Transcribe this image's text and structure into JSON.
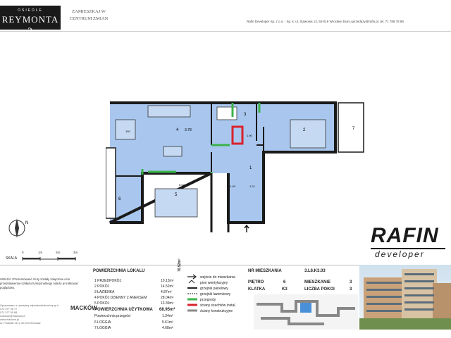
{
  "header": {
    "logo_top": "OSIEDLE",
    "logo_main": "REYMONTA 3",
    "slogan": "ZAMIESZKAJ W CENTRUM ZMIAN",
    "company": "Rafin Developer Sp. z o.o. - Sp. k. ul. Stawowa 13, 50-018 Wrocław, biuro.sprzedazy@rafin.pl, tel. 71 788 78 88"
  },
  "plan": {
    "rooms": [
      {
        "num": "4",
        "dim": "3.78"
      },
      {
        "num": "3"
      },
      {
        "num": "2"
      },
      {
        "num": "1"
      },
      {
        "num": "5"
      },
      {
        "num": "6"
      },
      {
        "num": "7"
      }
    ],
    "dims": [
      "150",
      "3.78",
      "6.52",
      "1.45",
      "1.21",
      "1.90"
    ]
  },
  "scale": {
    "label": "SKALA",
    "ticks": [
      "0",
      "1m",
      "2m",
      "3m"
    ],
    "compass": "N"
  },
  "brand": {
    "name": "RAFIN",
    "sub": "developer"
  },
  "disclaimer": "UWAGA ! Prezentowane rzuty zostały załączone celu przedstawienia rozkładu funkcjonalnego należy je traktować poglądowo.",
  "architect": {
    "lines": [
      "Opracowano z uprzejmą odpowiedzialnością sp.k.",
      "071 377 05 77",
      "071 377 05 88",
      "mackow@mackow.pl",
      "www.mackow.pl",
      "ul. Podwale 41/1, 50-010 Wrocław"
    ],
    "logo": "MACKÓW"
  },
  "area": {
    "title": "POWIERZCHNIA LOKALU",
    "total_vertical": "70.92m²",
    "rooms": [
      {
        "label": "1 PRZEDPOKÓJ",
        "value": "10.13m²"
      },
      {
        "label": "2 POKÓJ",
        "value": "14.52m²"
      },
      {
        "label": "3 ŁAZIENKA",
        "value": "4.87m²"
      },
      {
        "label": "4 POKÓJ DZIENNY Z ANEKSEM",
        "value": "28.04m²"
      },
      {
        "label": "5 POKÓJ",
        "value": "13.39m²"
      }
    ],
    "usable_label": "POWIERZCHNIA UŻYTKOWA",
    "usable_value": "68.95m²",
    "partition_label": "Powierzchnia przegród",
    "partition_value": "1.34m²",
    "extras": [
      {
        "label": "6 LOGGIA",
        "value": "5.61m²"
      },
      {
        "label": "7 LOGGIA",
        "value": "4.68m²"
      }
    ]
  },
  "legend": [
    {
      "label": "wejście do mieszkania",
      "color": "#222222"
    },
    {
      "label": "pion wentylacyjny",
      "color": "#222222"
    },
    {
      "label": "grzejnik panelowy",
      "color": "#222222"
    },
    {
      "label": "grzejnik łazienkowy",
      "color": "#222222"
    },
    {
      "label": "przegrody",
      "color": "#3bb34a"
    },
    {
      "label": "ściany szachtów instal.",
      "color": "#d9232d"
    },
    {
      "label": "ściany konstrukcyjne",
      "color": "#8a8a8a"
    }
  ],
  "unit": {
    "nr_label": "NR MIESZKANIA",
    "nr_value": "3.L6.K3.03",
    "pietro_label": "PIĘTRO",
    "pietro_value": "6",
    "mieszkanie_label": "MIESZKANIE",
    "mieszkanie_value": "3",
    "klatka_label": "KLATKA",
    "klatka_value": "K3",
    "pokoje_label": "LICZBA POKOI",
    "pokoje_value": "3"
  },
  "colors": {
    "room_fill": "#a9c7ee",
    "partition": "#3bb34a",
    "shaft": "#d9232d",
    "wall": "#1a1a1a"
  }
}
